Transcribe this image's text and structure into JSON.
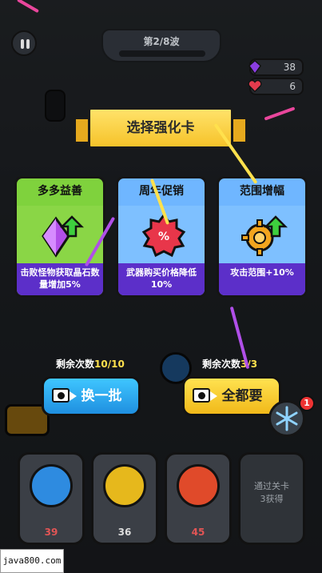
{
  "hud": {
    "wave_text": "第2/8波",
    "gems": "38",
    "hearts": "6"
  },
  "dialog": {
    "title": "选择强化卡",
    "cards": [
      {
        "title": "多多益善",
        "desc": "击败怪物获取晶石数量增加5%",
        "color_head": "#7fd23d",
        "icon": "purple-gem-up-icon"
      },
      {
        "title": "周年促销",
        "desc": "武器购买价格降低10%",
        "color_head": "#6fb6ff",
        "icon": "red-sale-badge-icon"
      },
      {
        "title": "范围增幅",
        "desc": "攻击范围+10%",
        "color_head": "#6fb6ff",
        "icon": "orange-target-up-icon"
      }
    ],
    "refresh": {
      "remaining_label": "剩余次数",
      "remaining_value": "10/10",
      "button_label": "换一批"
    },
    "take_all": {
      "remaining_label": "剩余次数",
      "remaining_value": "3/3",
      "button_label": "全都要"
    }
  },
  "slots": [
    {
      "cost": "39",
      "color": "#2e8be0"
    },
    {
      "cost": "36",
      "color": "#e6b81c"
    },
    {
      "cost": "45",
      "color": "#e04a2a"
    }
  ],
  "locked_slot": {
    "label": "通过关卡\n3获得"
  },
  "skill_badge": "1",
  "watermark": "java800.com"
}
